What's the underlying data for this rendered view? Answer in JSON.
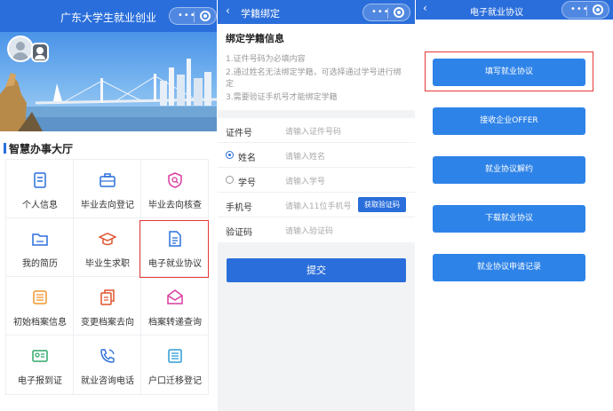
{
  "colors": {
    "primary": "#2a6edb",
    "button": "#2e83e8",
    "highlight": "#e53935"
  },
  "panel1": {
    "nav_title": "广东大学生就业创业",
    "capsule": {
      "more_icon": "more-dots-icon",
      "close_icon": "target-icon"
    },
    "section_title": "智慧办事大厅",
    "items": [
      {
        "label": "个人信息",
        "icon": "document-icon"
      },
      {
        "label": "毕业去向登记",
        "icon": "briefcase-icon"
      },
      {
        "label": "毕业去向核查",
        "icon": "shield-search-icon"
      },
      {
        "label": "我的简历",
        "icon": "folder-icon"
      },
      {
        "label": "毕业生求职",
        "icon": "graduation-cap-icon"
      },
      {
        "label": "电子就业协议",
        "icon": "document-lines-icon"
      },
      {
        "label": "初始档案信息",
        "icon": "archive-icon"
      },
      {
        "label": "变更档案去向",
        "icon": "files-icon"
      },
      {
        "label": "档案转递查询",
        "icon": "mail-open-icon"
      },
      {
        "label": "电子报到证",
        "icon": "id-card-icon"
      },
      {
        "label": "就业咨询电话",
        "icon": "phone-icon"
      },
      {
        "label": "户口迁移登记",
        "icon": "list-icon"
      }
    ]
  },
  "panel2": {
    "nav_title": "学籍绑定",
    "back": "‹",
    "card_title": "绑定学籍信息",
    "notes": [
      "1.证件号码为必填内容",
      "2.通过姓名无法绑定学籍，可选择通过学号进行绑定",
      "3.需要验证手机号才能绑定学籍"
    ],
    "fields": [
      {
        "label": "证件号",
        "placeholder": "请输入证件号码"
      },
      {
        "label": "姓名",
        "placeholder": "请输入姓名",
        "radio": true,
        "selected": true
      },
      {
        "label": "学号",
        "placeholder": "请输入学号",
        "radio": true,
        "selected": false
      },
      {
        "label": "手机号",
        "placeholder": "请输入11位手机号"
      },
      {
        "label": "验证码",
        "placeholder": "请输入验证码"
      }
    ],
    "code_button": "获取验证码",
    "submit": "提交"
  },
  "panel3": {
    "nav_title": "电子就业协议",
    "back": "‹",
    "buttons": [
      "填写就业协议",
      "接收企业OFFER",
      "就业协议解约",
      "下载就业协议",
      "就业协议申请记录"
    ]
  }
}
